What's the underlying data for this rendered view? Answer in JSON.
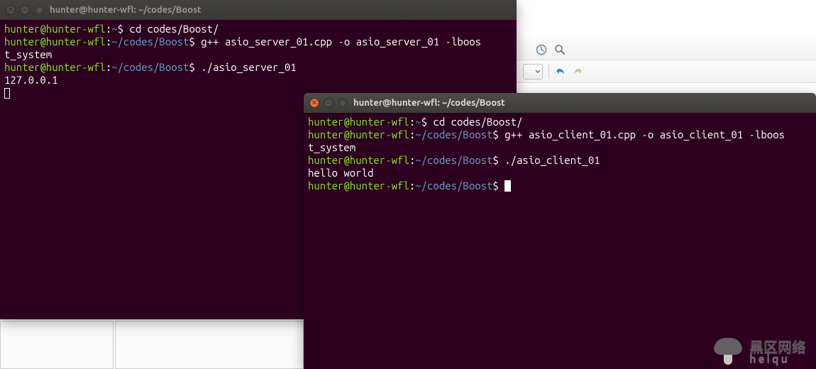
{
  "bg_app": {
    "icons": {
      "clock": "clock-icon",
      "zoom": "magnifier-icon",
      "undo": "undo-icon",
      "redo": "redo-icon",
      "dropdown": "dropdown-icon"
    }
  },
  "terminal1": {
    "title": "hunter@hunter-wfl: ~/codes/Boost",
    "prompt_user": "hunter@hunter-wfl",
    "lines": [
      {
        "path": "~",
        "cmd": "cd codes/Boost/"
      },
      {
        "path": "~/codes/Boost",
        "cmd": "g++ asio_server_01.cpp -o asio_server_01 -lboos",
        "wrap": "t_system"
      },
      {
        "path": "~/codes/Boost",
        "cmd": "./asio_server_01"
      }
    ],
    "output": "127.0.0.1"
  },
  "terminal2": {
    "title": "hunter@hunter-wfl: ~/codes/Boost",
    "prompt_user": "hunter@hunter-wfl",
    "lines": [
      {
        "path": "~",
        "cmd": "cd codes/Boost/"
      },
      {
        "path": "~/codes/Boost",
        "cmd": "g++ asio_client_01.cpp -o asio_client_01 -lboos",
        "wrap": "t_system"
      },
      {
        "path": "~/codes/Boost",
        "cmd": "./asio_client_01"
      }
    ],
    "output": "hello world",
    "trailing_prompt_path": "~/codes/Boost"
  },
  "watermark": {
    "line1": "黑区网络",
    "line2": "heiqu"
  },
  "colors": {
    "terminal_bg": "#2c001e",
    "prompt_user": "#8ae234",
    "prompt_path": "#729fcf",
    "close_btn_active": "#e95420"
  }
}
